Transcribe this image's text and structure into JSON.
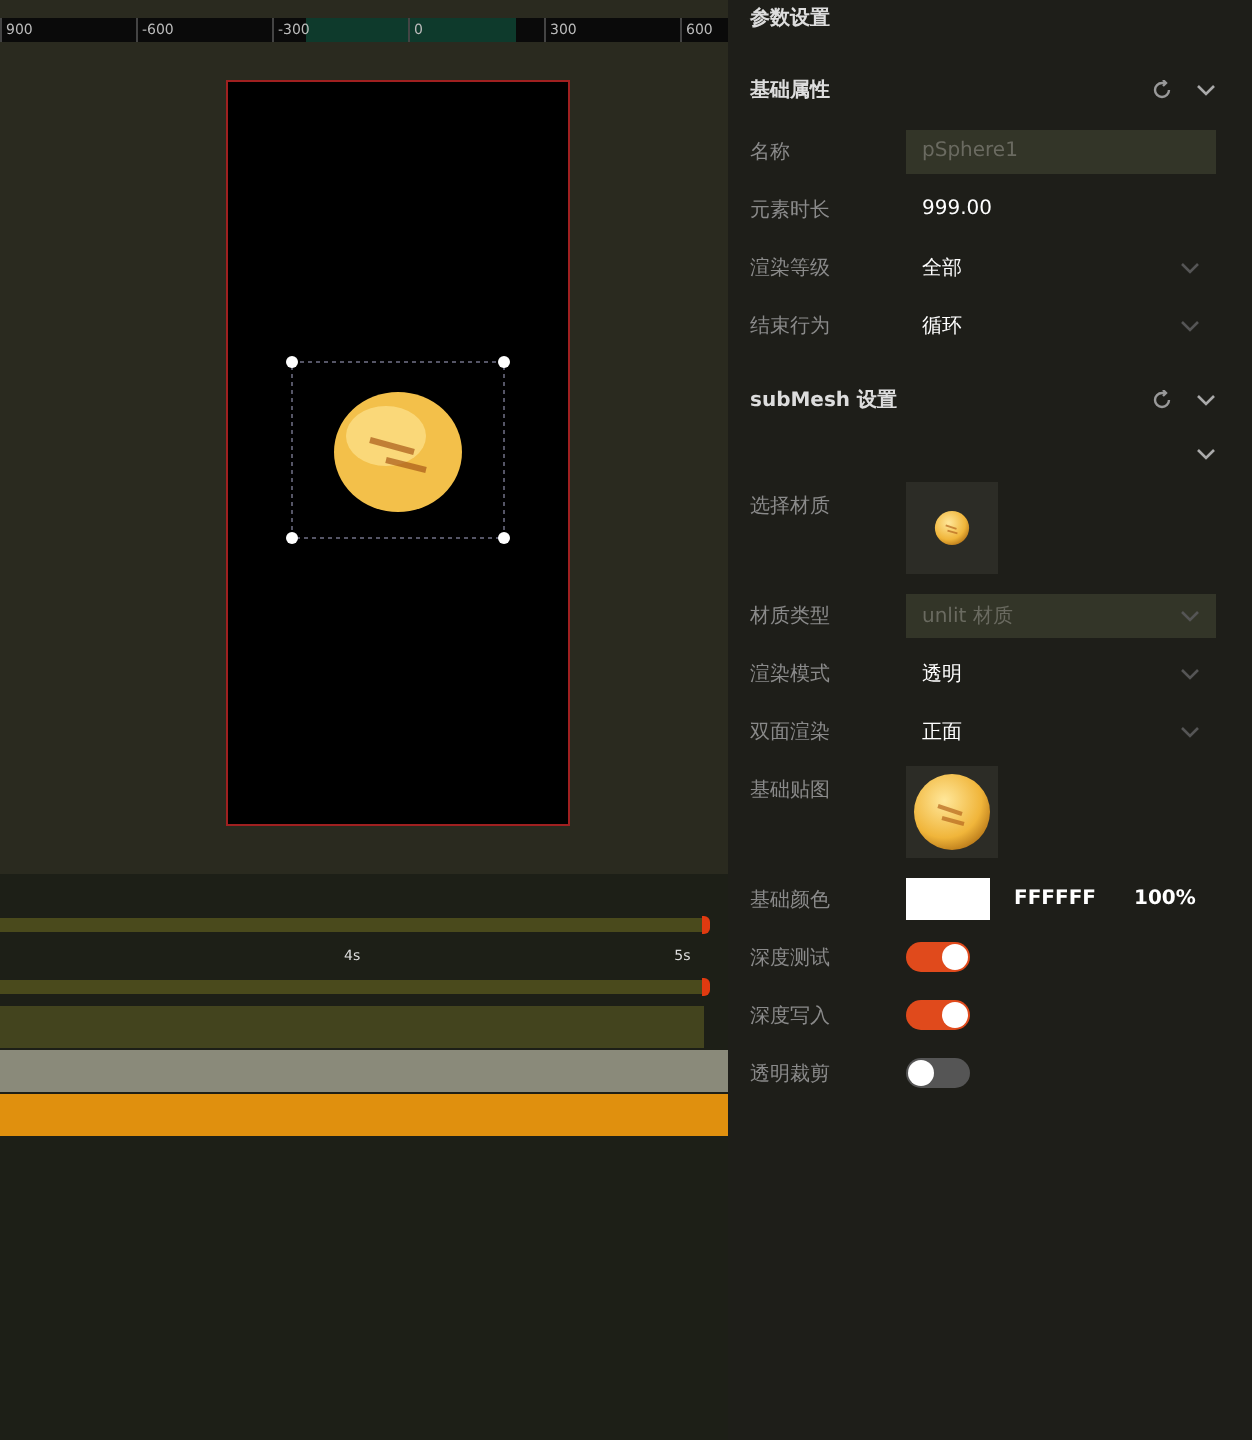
{
  "ruler": {
    "labels": [
      "900",
      "-600",
      "-300",
      "0",
      "300",
      "600"
    ]
  },
  "timeline": {
    "time_labels": [
      "4s",
      "5s"
    ],
    "tracks": [
      {
        "kind": "thin",
        "color": "#4a4a1c",
        "marker": true
      },
      {
        "kind": "thin",
        "color": "#4a4a1c",
        "marker": true
      },
      {
        "kind": "short",
        "color": "#43441e",
        "marker": false
      },
      {
        "kind": "full",
        "color": "#8a8a7a",
        "marker": false
      },
      {
        "kind": "full",
        "color": "#e0900e",
        "marker": false
      }
    ]
  },
  "panel": {
    "title": "参数设置",
    "sections": [
      {
        "title": "基础属性",
        "rows": [
          {
            "kind": "input",
            "label": "名称",
            "value": "pSphere1",
            "disabled": true
          },
          {
            "kind": "text",
            "label": "元素时长",
            "value": "999.00"
          },
          {
            "kind": "select",
            "label": "渲染等级",
            "value": "全部",
            "disabled": false
          },
          {
            "kind": "select",
            "label": "结束行为",
            "value": "循环",
            "disabled": false
          }
        ]
      },
      {
        "title": "subMesh 设置",
        "rows": [
          {
            "kind": "collapse"
          },
          {
            "kind": "material",
            "label": "选择材质"
          },
          {
            "kind": "select",
            "label": "材质类型",
            "value": "unlit 材质",
            "disabled": true
          },
          {
            "kind": "select",
            "label": "渲染模式",
            "value": "透明",
            "disabled": false
          },
          {
            "kind": "select",
            "label": "双面渲染",
            "value": "正面",
            "disabled": false
          },
          {
            "kind": "texture",
            "label": "基础贴图"
          },
          {
            "kind": "color",
            "label": "基础颜色",
            "color": "#ffffff",
            "value": "FFFFFF",
            "opacity": "100%"
          },
          {
            "kind": "toggle",
            "label": "深度测试",
            "on": true
          },
          {
            "kind": "toggle",
            "label": "深度写入",
            "on": true
          },
          {
            "kind": "toggle",
            "label": "透明裁剪",
            "on": false
          }
        ]
      }
    ]
  }
}
